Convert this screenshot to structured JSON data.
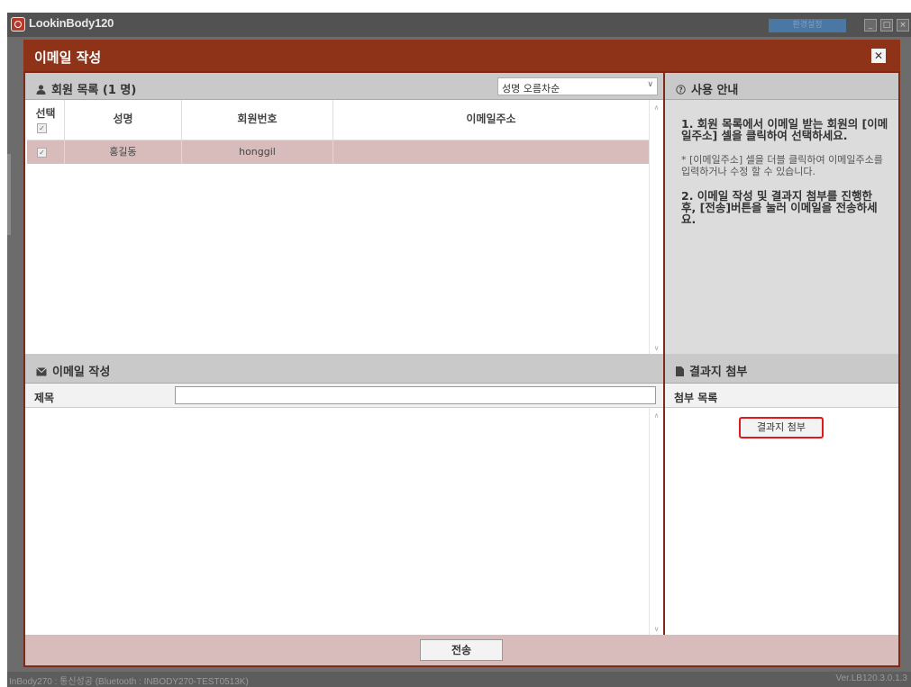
{
  "app": {
    "title": "LookinBody120",
    "settings_button": "환경설정",
    "status_left": "InBody270 : 통신성공 (Bluetooth : INBODY270-TEST0513K)",
    "status_right": "Ver.LB120.3.0.1.3"
  },
  "dialog": {
    "title": "이메일 작성",
    "close_glyph": "✕"
  },
  "members": {
    "header": "회원 목록 (1 명)",
    "sort": {
      "selected": "성명 오름차순"
    },
    "columns": [
      "선택",
      "성명",
      "회원번호",
      "이메일주소"
    ],
    "rows": [
      {
        "checked": true,
        "name": "홍길동",
        "member_id": "honggil",
        "email": ""
      }
    ]
  },
  "guide": {
    "header": "사용 안내",
    "step1": "1. 회원 목록에서 이메일 받는 회원의 [이메일주소] 셀을 클릭하여 선택하세요.",
    "note": "* [이메일주소] 셀을 더블 클릭하여 이메일주소를 입력하거나 수정 할 수 있습니다.",
    "step2": "2. 이메일 작성 및 결과지 첨부를 진행한 후, [전송]버튼을 눌러 이메일을 전송하세요."
  },
  "compose": {
    "header": "이메일 작성",
    "subject_label": "제목",
    "subject_value": "",
    "body_value": ""
  },
  "attach": {
    "header": "결과지 첨부",
    "list_label": "첨부 목록",
    "button": "결과지 첨부"
  },
  "footer": {
    "send_button": "전송"
  },
  "colors": {
    "dialog_frame": "#7e2a18",
    "selected_row": "#d8bcbc",
    "panel_bar": "#c9c9c9",
    "highlight": "#e01a1a"
  }
}
